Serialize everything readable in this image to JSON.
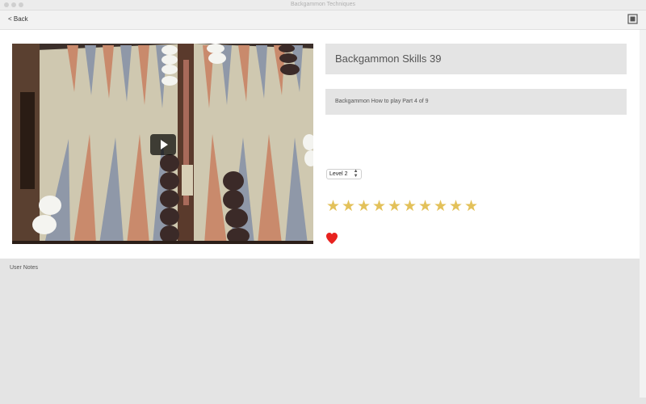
{
  "window": {
    "title": "Backgammon Techniques"
  },
  "toolbar": {
    "back_label": "< Back"
  },
  "video": {
    "title": "Backgammon Skills 39",
    "description": "Backgammon How to play Part 4 of 9"
  },
  "level": {
    "selected": "Level 2"
  },
  "rating": {
    "stars": 10,
    "max": 10
  },
  "favorite": {
    "icon": "heart-icon",
    "color": "#e8221f"
  },
  "notes": {
    "label": "User Notes"
  },
  "colors": {
    "accent_star": "#e3c15a",
    "panel_gray": "#e4e4e4"
  }
}
